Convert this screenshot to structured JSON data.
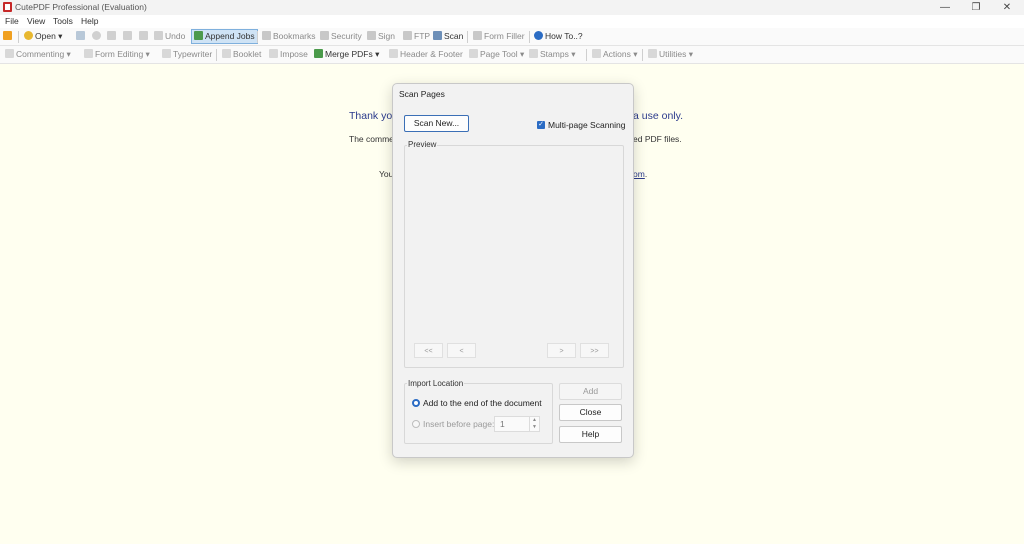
{
  "window": {
    "title": "CutePDF Professional (Evaluation)",
    "minimize": "—",
    "restore": "❐",
    "close": "✕"
  },
  "menu": [
    "File",
    "View",
    "Tools",
    "Help"
  ],
  "toolbar1": {
    "open": "Open",
    "undo": "Undo",
    "append_jobs": "Append Jobs",
    "bookmarks": "Bookmarks",
    "security": "Security",
    "sign": "Sign",
    "ftp": "FTP",
    "scan": "Scan",
    "form_filler": "Form Filler",
    "how_to": "How To..?"
  },
  "toolbar2": {
    "commenting": "Commenting",
    "form_editing": "Form Editing",
    "typewriter": "Typewriter",
    "booklet": "Booklet",
    "impose": "Impose",
    "merge_pdfs": "Merge PDFs",
    "header_footer": "Header & Footer",
    "page_tool": "Page Tool",
    "stamps": "Stamps",
    "actions": "Actions",
    "utilities": "Utilities"
  },
  "doc": {
    "line1_left": "Thank you",
    "line1_right": "a use only.",
    "line2_left": "The comme",
    "line2_right": "ed PDF files.",
    "line3_left": "You",
    "line3_right": "om",
    "line3_dot": "."
  },
  "dialog": {
    "title": "Scan Pages",
    "scan_new": "Scan New...",
    "multipage_label": "Multi-page Scanning",
    "multipage_checked": true,
    "preview_label": "Preview",
    "nav_first": "<<",
    "nav_prev": "<",
    "nav_next": ">",
    "nav_last": ">>",
    "import_location_label": "Import Location",
    "radio_end": "Add to the end of the document",
    "radio_insert": "Insert before page:",
    "insert_page_value": "1",
    "add_button": "Add",
    "close_button": "Close",
    "help_button": "Help"
  },
  "colors": {
    "accent": "#2b6cc4",
    "doc_bg": "#fffff0",
    "link": "#2b3a8c"
  }
}
